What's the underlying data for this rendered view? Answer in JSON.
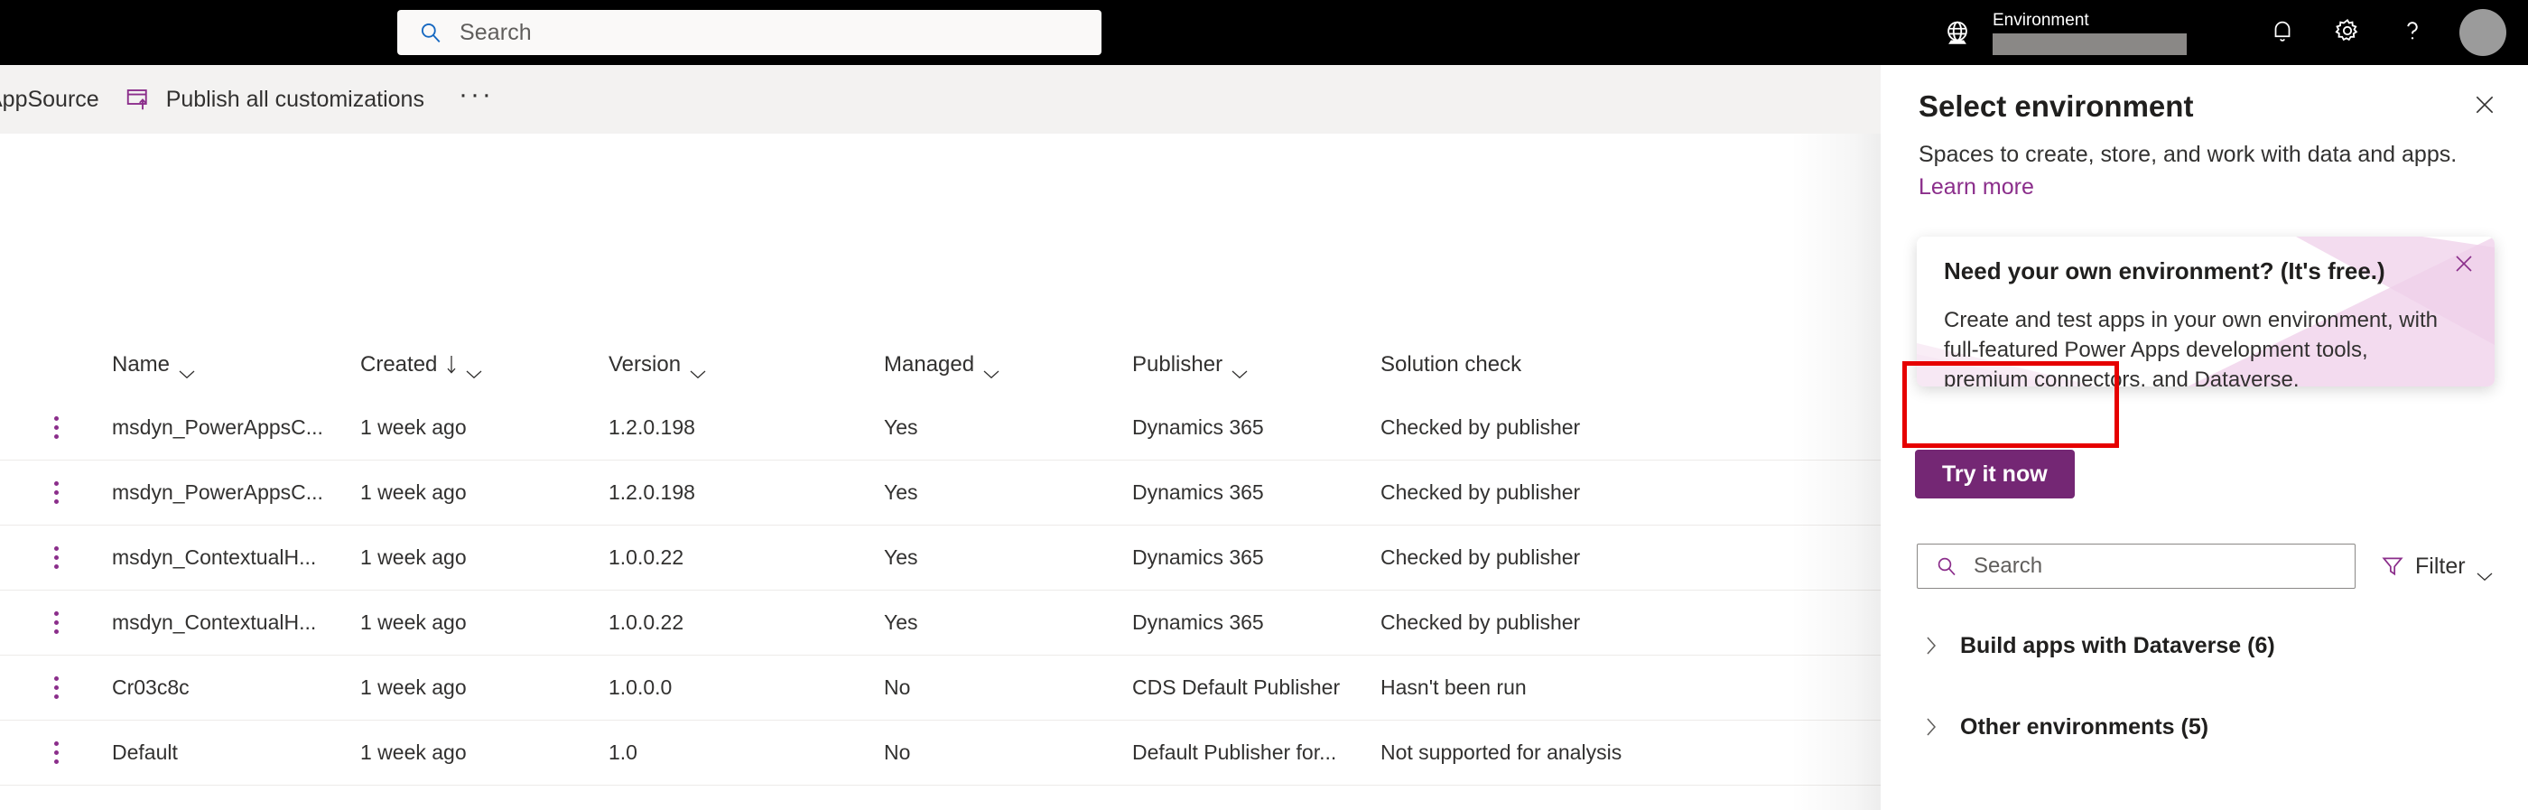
{
  "header": {
    "search": {
      "placeholder": "Search",
      "icon": "search-icon"
    },
    "environment": {
      "label": "Environment",
      "value": ""
    },
    "icons": {
      "globe": "globe-icon",
      "notifications": "bell-icon",
      "settings": "gear-icon",
      "help": "question-mark-icon",
      "avatar": "avatar"
    },
    "background_color": "#000000"
  },
  "command_bar": {
    "items": [
      {
        "label": "AppSource",
        "icon": null
      },
      {
        "label": "Publish all customizations",
        "icon": "publish-icon"
      }
    ],
    "overflow_label": "···",
    "background_color": "#f3f2f1"
  },
  "table": {
    "columns": [
      {
        "label": "Name",
        "sortable": true,
        "sorted": null
      },
      {
        "label": "Created",
        "sortable": true,
        "sorted": "desc"
      },
      {
        "label": "Version",
        "sortable": true,
        "sorted": null
      },
      {
        "label": "Managed",
        "sortable": true,
        "sorted": null
      },
      {
        "label": "Publisher",
        "sortable": true,
        "sorted": null
      },
      {
        "label": "Solution check",
        "sortable": false,
        "sorted": null
      }
    ],
    "rows": [
      {
        "name": "msdyn_PowerAppsC...",
        "created": "1 week ago",
        "version": "1.2.0.198",
        "managed": "Yes",
        "publisher": "Dynamics 365",
        "solution_check": "Checked by publisher"
      },
      {
        "name": "msdyn_PowerAppsC...",
        "created": "1 week ago",
        "version": "1.2.0.198",
        "managed": "Yes",
        "publisher": "Dynamics 365",
        "solution_check": "Checked by publisher"
      },
      {
        "name": "msdyn_ContextualH...",
        "created": "1 week ago",
        "version": "1.0.0.22",
        "managed": "Yes",
        "publisher": "Dynamics 365",
        "solution_check": "Checked by publisher"
      },
      {
        "name": "msdyn_ContextualH...",
        "created": "1 week ago",
        "version": "1.0.0.22",
        "managed": "Yes",
        "publisher": "Dynamics 365",
        "solution_check": "Checked by publisher"
      },
      {
        "name": "Cr03c8c",
        "created": "1 week ago",
        "version": "1.0.0.0",
        "managed": "No",
        "publisher": "CDS Default Publisher",
        "solution_check": "Hasn't been run"
      },
      {
        "name": "Default",
        "created": "1 week ago",
        "version": "1.0",
        "managed": "No",
        "publisher": "Default Publisher for...",
        "solution_check": "Not supported for analysis"
      }
    ]
  },
  "panel": {
    "title": "Select environment",
    "subtitle": "Spaces to create, store, and work with data and apps.",
    "learn_more": "Learn more",
    "close_icon": "close-icon",
    "search": {
      "placeholder": "Search",
      "icon": "search-icon"
    },
    "filter": {
      "label": "Filter",
      "icon": "filter-icon"
    },
    "groups": [
      {
        "label": "Build apps with Dataverse (6)",
        "expanded": false
      },
      {
        "label": "Other environments (5)",
        "expanded": false
      }
    ]
  },
  "callout": {
    "title": "Need your own environment? (It's free.)",
    "body": "Create and test apps in your own environment, with full-featured Power Apps development tools, premium connectors, and Dataverse.",
    "button_label": "Try it now",
    "close_icon": "close-icon"
  },
  "colors": {
    "accent_purple": "#8b2e8b",
    "button_purple": "#742774",
    "header_black": "#000000",
    "command_bar_grey": "#f3f2f1",
    "highlight_red": "#e60000"
  }
}
